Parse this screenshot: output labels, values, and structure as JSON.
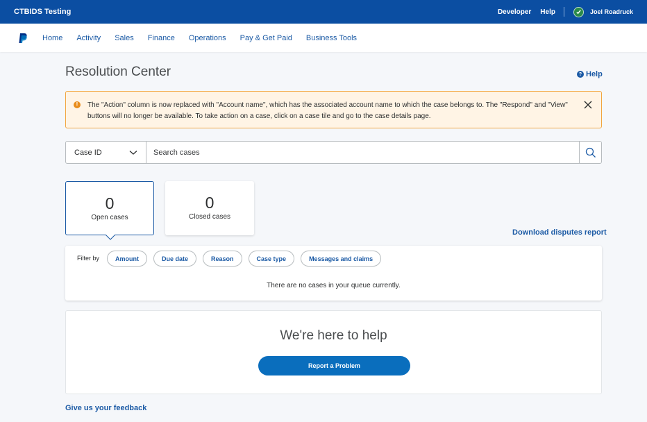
{
  "topbar": {
    "brand": "CTBIDS Testing",
    "developer": "Developer",
    "help": "Help",
    "user_name": "Joel Roadruck",
    "background_color": "#0b4ea2"
  },
  "nav": {
    "logo_icon": "paypal-logo-icon",
    "items": [
      "Home",
      "Activity",
      "Sales",
      "Finance",
      "Operations",
      "Pay & Get Paid",
      "Business Tools"
    ]
  },
  "page": {
    "title": "Resolution Center",
    "help_link": "Help"
  },
  "alert": {
    "icon": "warning-icon",
    "message": "The \"Action\" column is now replaced with \"Account name\", which has the associated account name to which the case belongs to. The \"Respond\" and \"View\" buttons will no longer be available. To take action on a case, click on a case tile and go to the case details page.",
    "close_icon": "close-icon"
  },
  "search": {
    "select_value": "Case ID",
    "placeholder": "Search cases",
    "search_icon": "search-icon"
  },
  "tiles": [
    {
      "count": "0",
      "label": "Open cases",
      "active": true
    },
    {
      "count": "0",
      "label": "Closed cases",
      "active": false
    }
  ],
  "download_link": "Download disputes report",
  "filter": {
    "label": "Filter by",
    "chips": [
      "Amount",
      "Due date",
      "Reason",
      "Case type",
      "Messages and claims"
    ],
    "empty_message": "There are no cases in your queue currently."
  },
  "help_card": {
    "heading": "We're here to help",
    "button_label": "Report a Problem"
  },
  "feedback_link": "Give us your feedback",
  "colors": {
    "link": "#1b5aa5",
    "primary_button": "#0a6ebd",
    "alert_border": "#f2a640",
    "alert_background": "#fff4e5",
    "warning": "#e88c1b"
  }
}
